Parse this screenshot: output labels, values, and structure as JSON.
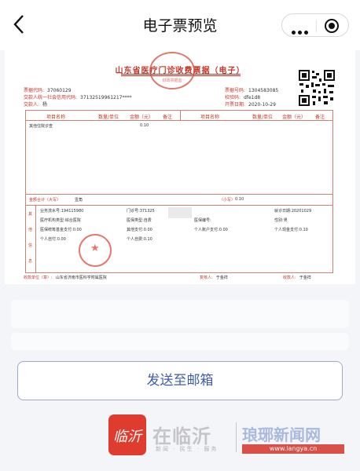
{
  "nav": {
    "title": "电子票预览"
  },
  "invoice": {
    "title": "山东省医疗门诊收费票据（电子）",
    "seal_top_line1": "山东省",
    "seal_top_line2": "财政票据监",
    "fields_left": [
      {
        "label": "票据代码:",
        "value": "37060129"
      },
      {
        "label": "交款人统一社会信用代码:",
        "value": "37132519961217****"
      },
      {
        "label": "交款人:",
        "value": "杨"
      }
    ],
    "fields_right": [
      {
        "label": "票据号码:",
        "value": "1304583085"
      },
      {
        "label": "校验码:",
        "value": "dfe1d8"
      },
      {
        "label": "开票日期:",
        "value": "2020-10-29"
      }
    ],
    "headers": [
      "项目名称",
      "数量/单位",
      "金额（元）",
      "备注",
      "项目名称",
      "数量/单位",
      "金额（元）",
      "备注"
    ],
    "item_row": {
      "name": "其他住院诊查",
      "amount": "0.10"
    },
    "total_label": "金额合计（大写）",
    "total_words": "壹角",
    "total_small_label": "（小写）",
    "total_small": "0.10",
    "side_label": [
      "其",
      "他",
      "信",
      "息"
    ],
    "other": {
      "serial_label": "业务流水号:",
      "serial_value": "194115980",
      "clinic_label": "门诊号:",
      "clinic_value": "371325",
      "visit_date_label": "就诊日期:",
      "visit_date_value": "20201029",
      "org_type_label": "医疗机构类型:",
      "org_type_value": "综合医院",
      "ins_type_label": "医保类型:",
      "ins_type_value": "自费",
      "ins_no_label": "医保编号:",
      "ins_no_value": "",
      "gender_label": "性别:",
      "gender_value": "男",
      "fund_label": "医保统筹基金支付:",
      "fund_value": "0.00",
      "other_pay_label": "其他支付:",
      "other_pay_value": "0.00",
      "acct_label": "个人账户支付:",
      "acct_value": "0.00",
      "cash_label": "个人现金支付:",
      "cash_value": "0.10",
      "self_pay_label": "个人自付:",
      "self_pay_value": "0.00",
      "self_fee_label": "个人自费:",
      "self_fee_value": "0.10"
    },
    "payee_unit_label": "收款单位（章）:",
    "payee_unit_value": "山东省济南市医科学附属医院",
    "reviewer_label": "复核人:",
    "reviewer_value": "于金祥",
    "payee_label": "收款人:",
    "payee_value": "于金祥"
  },
  "action": {
    "send_email_label": "发送至邮箱"
  },
  "watermark": {
    "logo_text": "临沂",
    "name": "在临沂",
    "sub": "新闻 · 民生 · 服务",
    "right": "琅琊新闻网",
    "url": "www.langya.cn"
  },
  "colors": {
    "invoice_red": "#c0392b",
    "button_text": "#3f5ea9",
    "background": "#f4f5f9"
  }
}
